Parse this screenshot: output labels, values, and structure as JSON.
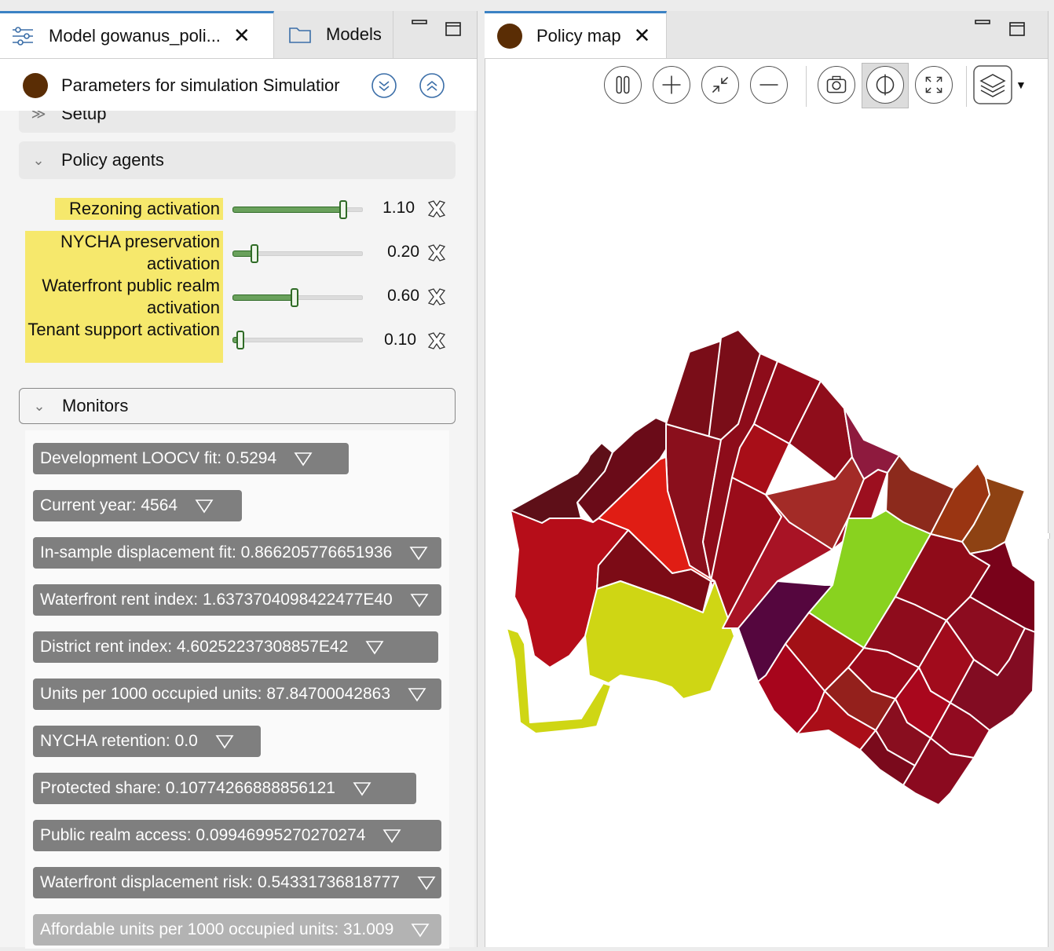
{
  "left_tabs": [
    {
      "label": "Model gowanus_poli...",
      "icon": "sliders-icon",
      "active": true
    },
    {
      "label": "Models",
      "icon": "folder-icon",
      "active": false
    }
  ],
  "param_header": {
    "title": "Parameters for simulation Simulatior",
    "color": "#5a2d05"
  },
  "sections": {
    "setup": "Setup",
    "policy_agents": "Policy agents",
    "monitors": "Monitors"
  },
  "parameters": [
    {
      "label": "Rezoning activation",
      "value_text": "1.10",
      "level": 0.86
    },
    {
      "label": "NYCHA preservation activation",
      "value_text": "0.20",
      "level": 0.17
    },
    {
      "label": "Waterfront public realm activation",
      "value_text": "0.60",
      "level": 0.48
    },
    {
      "label": "Tenant support activation",
      "value_text": "0.10",
      "level": 0.06
    }
  ],
  "monitors": [
    "Development LOOCV fit: 0.5294",
    "Current year: 4564",
    "In-sample displacement fit: 0.866205776651936",
    "Waterfront rent index: 1.6373704098422477E40",
    "District rent index: 4.60252237308857E42",
    "Units per 1000 occupied units: 87.84700042863",
    "NYCHA retention: 0.0",
    "Protected share: 0.10774266888856121",
    "Public realm access: 0.09946995270270274",
    "Waterfront displacement risk: 0.54331736818777",
    "Affordable units per 1000 occupied units: 31.009"
  ],
  "right_tab": {
    "label": "Policy map",
    "color": "#5a2d05"
  },
  "toolbar": [
    "pause-icon",
    "zoom-in-icon",
    "zoom-fit-icon",
    "zoom-out-icon",
    "camera-icon",
    "contrast-icon",
    "fullscreen-icon",
    "layers-icon"
  ],
  "colors": {
    "accent": "#3b82c4",
    "slider": "#6aa15c",
    "highlight": "#f6e86c",
    "monitor_bg": "#7f7f7f"
  }
}
